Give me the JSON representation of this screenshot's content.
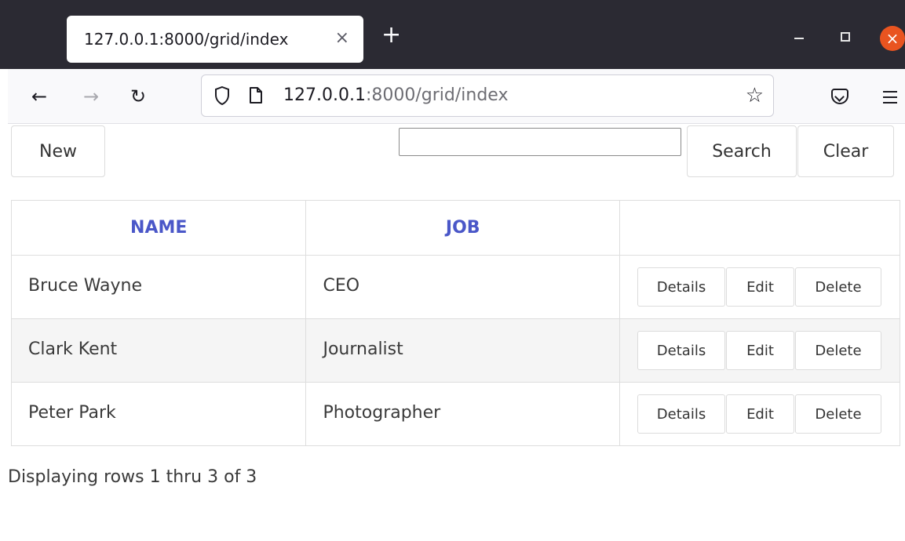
{
  "browser": {
    "tab_title": "127.0.0.1:8000/grid/index",
    "tab_close": "×",
    "new_tab": "+",
    "window_close": "×",
    "url_host": "127.0.0.1",
    "url_rest": ":8000/grid/index"
  },
  "toolbar": {
    "new_label": "New",
    "search_value": "",
    "search_label": "Search",
    "clear_label": "Clear"
  },
  "grid": {
    "headers": [
      "NAME",
      "JOB",
      ""
    ],
    "rows": [
      {
        "name": "Bruce Wayne",
        "job": "CEO"
      },
      {
        "name": "Clark Kent",
        "job": "Journalist"
      },
      {
        "name": "Peter Park",
        "job": "Photographer"
      }
    ],
    "actions": {
      "details": "Details",
      "edit": "Edit",
      "delete": "Delete"
    },
    "header_color": "#4a57c8"
  },
  "footer": {
    "summary": "Displaying rows 1 thru 3 of 3"
  },
  "icons": [
    "back-arrow-icon",
    "forward-arrow-icon",
    "reload-icon",
    "shield-icon",
    "page-icon",
    "star-icon",
    "pocket-icon",
    "menu-icon",
    "minimize-icon",
    "maximize-icon",
    "close-icon"
  ]
}
